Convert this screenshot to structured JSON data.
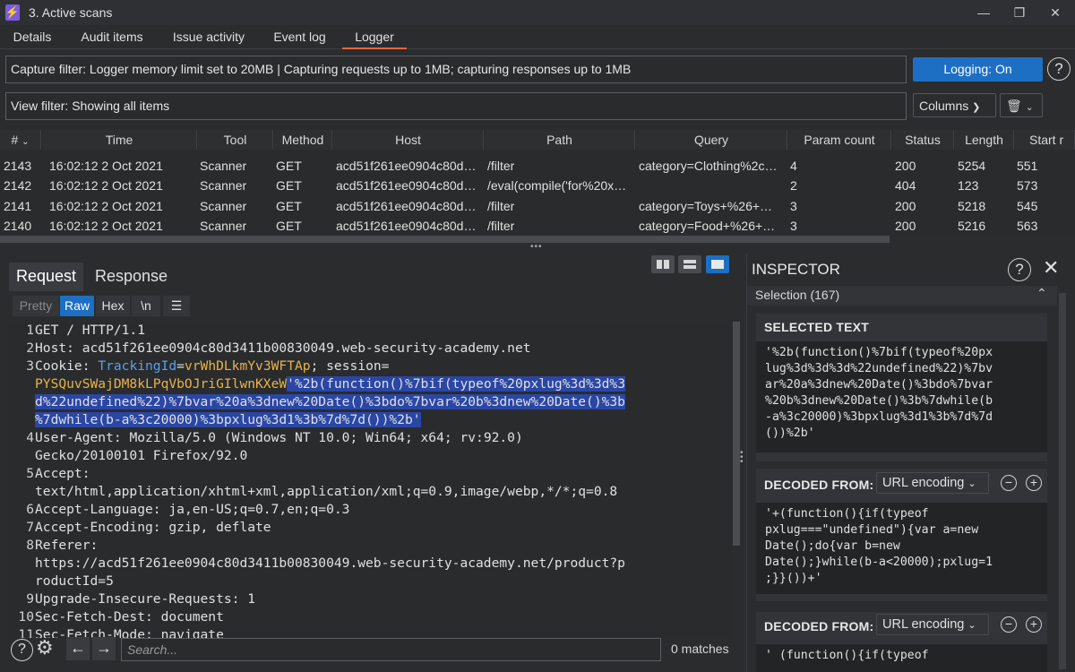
{
  "window": {
    "title": "3. Active scans"
  },
  "tabs": [
    {
      "label": "Details"
    },
    {
      "label": "Audit items"
    },
    {
      "label": "Issue activity"
    },
    {
      "label": "Event log"
    },
    {
      "label": "Logger",
      "active": true
    }
  ],
  "capture_filter": "Capture filter: Logger memory limit set to 20MB | Capturing requests up to 1MB;  capturing responses up to 1MB",
  "view_filter": "View filter: Showing all items",
  "logging_button": "Logging: On",
  "columns_button": "Columns",
  "table": {
    "headers": [
      "#",
      "Time",
      "Tool",
      "Method",
      "Host",
      "Path",
      "Query",
      "Param count",
      "Status",
      "Length",
      "Start r"
    ],
    "rows": [
      [
        "2143",
        "16:02:12 2 Oct 2021",
        "Scanner",
        "GET",
        "acd51f261ee0904c80d…",
        "/filter",
        "category=Clothing%2c…",
        "4",
        "200",
        "5254",
        "551"
      ],
      [
        "2142",
        "16:02:12 2 Oct 2021",
        "Scanner",
        "GET",
        "acd51f261ee0904c80d…",
        "/eval(compile('for%20x…",
        "",
        "2",
        "404",
        "123",
        "573"
      ],
      [
        "2141",
        "16:02:12 2 Oct 2021",
        "Scanner",
        "GET",
        "acd51f261ee0904c80d…",
        "/filter",
        "category=Toys+%26+…",
        "3",
        "200",
        "5218",
        "545"
      ],
      [
        "2140",
        "16:02:12 2 Oct 2021",
        "Scanner",
        "GET",
        "acd51f261ee0904c80d…",
        "/filter",
        "category=Food+%26+…",
        "3",
        "200",
        "5216",
        "563"
      ]
    ]
  },
  "request_tabs": [
    "Request",
    "Response"
  ],
  "sub_tabs": [
    "Pretty",
    "Raw",
    "Hex",
    "\\n"
  ],
  "request": {
    "l1": "GET / HTTP/1.1",
    "l2k": "Host: ",
    "l2v": "acd51f261ee0904c80d3411b00830049.web-security-academy.net",
    "l3k": "Cookie: ",
    "l3a": "TrackingId",
    "l3b": "=",
    "l3c": "vrWhDLkmYv3WFTAp",
    "l3d": "; session=",
    "l3e": "PYSQuvSWajDM8kLPqVbOJriGIlwnKXeW",
    "l3f": "'%2b(function()%7bif(typeof%20pxlug%3d%3d%3",
    "l3g": "d%22undefined%22)%7bvar%20a%3dnew%20Date()%3bdo%7bvar%20b%3dnew%20Date()%3b",
    "l3h": "%7dwhile(b-a%3c20000)%3bpxlug%3d1%3b%7d%7d())%2b'",
    "l4k": "User-Agent: ",
    "l4v": "Mozilla/5.0 (Windows NT 10.0; Win64; x64; rv:92.0)",
    "l4w": "Gecko/20100101 Firefox/92.0",
    "l5k": "Accept:",
    "l5v": "text/html,application/xhtml+xml,application/xml;q=0.9,image/webp,*/*;q=0.8",
    "l6k": "Accept-Language: ",
    "l6v": "ja,en-US;q=0.7,en;q=0.3",
    "l7k": "Accept-Encoding: ",
    "l7v": "gzip, deflate",
    "l8k": "Referer:",
    "l8v": "https://acd51f261ee0904c80d3411b00830049.web-security-academy.net/product?p",
    "l8w": "roductId=5",
    "l9k": "Upgrade-Insecure-Requests: ",
    "l9v": "1",
    "l10k": "Sec-Fetch-Dest: ",
    "l10v": "document",
    "l11k": "Sec-Fetch-Mode: ",
    "l11v": "navigate",
    "line_numbers": [
      "1",
      "2",
      "3",
      "4",
      "5",
      "6",
      "7",
      "8",
      "9",
      "10",
      "11"
    ]
  },
  "search": {
    "placeholder": "Search...",
    "matches": "0 matches"
  },
  "inspector": {
    "title": "INSPECTOR",
    "selection": "Selection (167)",
    "selected_text_label": "SELECTED TEXT",
    "selected_text": "'%2b(function()%7bif(typeof%20px\nlug%3d%3d%3d%22undefined%22)%7bv\nar%20a%3dnew%20Date()%3bdo%7bvar\n%20b%3dnew%20Date()%3b%7dwhile(b\n-a%3c20000)%3bpxlug%3d1%3b%7d%7d\n())%2b'",
    "decoded_label": "DECODED FROM:",
    "decoded_1_encoding": "URL encoding",
    "decoded_1_text": "'+(function(){if(typeof\npxlug===\"undefined\"){var a=new\nDate();do{var b=new\nDate();}while(b-a<20000);pxlug=1\n;}}())+'",
    "decoded_2_encoding": "URL encoding",
    "decoded_2_text": "' (function(){if(typeof"
  }
}
